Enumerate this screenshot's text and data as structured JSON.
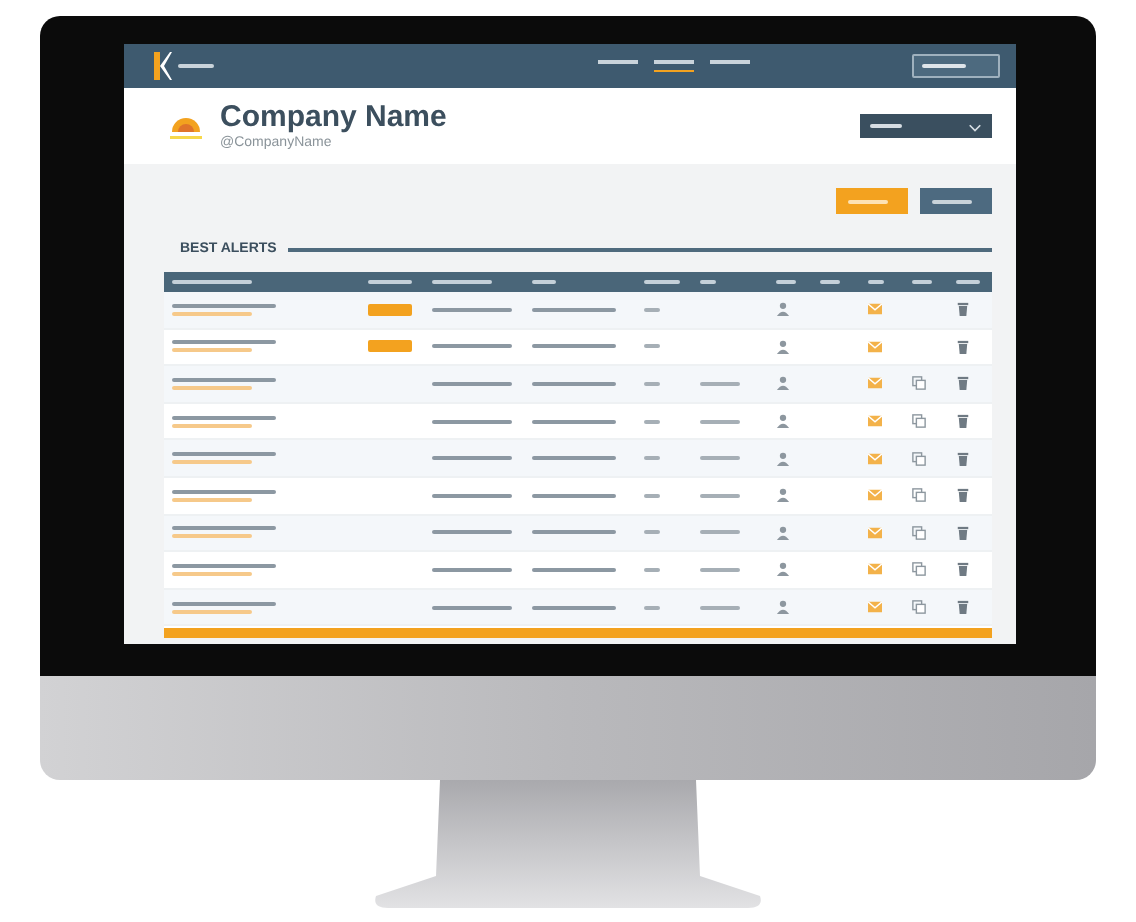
{
  "nav": {
    "items": [
      {
        "selected": false
      },
      {
        "selected": true
      },
      {
        "selected": false
      }
    ]
  },
  "profile": {
    "name": "Company Name",
    "handle": "@CompanyName"
  },
  "section": {
    "title": "BEST ALERTS"
  },
  "table": {
    "rows": [
      {
        "badge": true,
        "details": false,
        "copy": false
      },
      {
        "badge": true,
        "details": false,
        "copy": false
      },
      {
        "badge": false,
        "details": true,
        "copy": true
      },
      {
        "badge": false,
        "details": true,
        "copy": true
      },
      {
        "badge": false,
        "details": true,
        "copy": true
      },
      {
        "badge": false,
        "details": true,
        "copy": true
      },
      {
        "badge": false,
        "details": true,
        "copy": true
      },
      {
        "badge": false,
        "details": true,
        "copy": true
      },
      {
        "badge": false,
        "details": true,
        "copy": true
      }
    ]
  }
}
